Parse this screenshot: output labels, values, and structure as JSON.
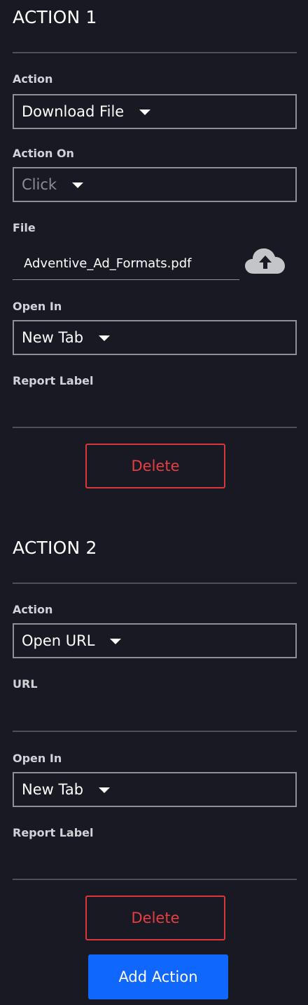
{
  "action1": {
    "title": "ACTION 1",
    "action_label": "Action",
    "action_value": "Download File",
    "action_on_label": "Action On",
    "action_on_value": "Click",
    "file_label": "File",
    "file_value": "Adventive_Ad_Formats.pdf",
    "open_in_label": "Open In",
    "open_in_value": "New Tab",
    "report_label": "Report Label",
    "delete_label": "Delete"
  },
  "action2": {
    "title": "ACTION 2",
    "action_label": "Action",
    "action_value": "Open URL",
    "url_label": "URL",
    "open_in_label": "Open In",
    "open_in_value": "New Tab",
    "report_label": "Report Label",
    "delete_label": "Delete"
  },
  "add_action_label": "Add Action",
  "icons": {
    "upload": "cloud-upload-icon",
    "dropdown": "caret-down-icon"
  },
  "colors": {
    "background": "#181923",
    "delete": "#e53f43",
    "primary": "#0f67fe"
  }
}
